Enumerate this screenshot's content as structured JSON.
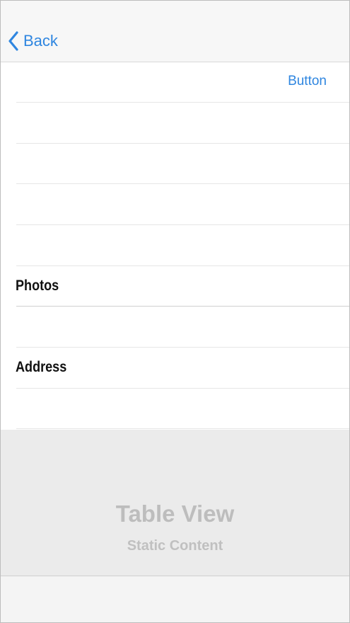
{
  "nav": {
    "back_label": "Back",
    "back_icon": "chevron-left-icon"
  },
  "table": {
    "button_label": "Button",
    "sections": {
      "photos_title": "Photos",
      "address_title": "Address"
    }
  },
  "placeholder": {
    "title": "Table View",
    "subtitle": "Static Content"
  },
  "colors": {
    "accent": "#2f86e0",
    "nav_background": "#f7f7f7",
    "placeholder_background": "#ebebeb"
  }
}
